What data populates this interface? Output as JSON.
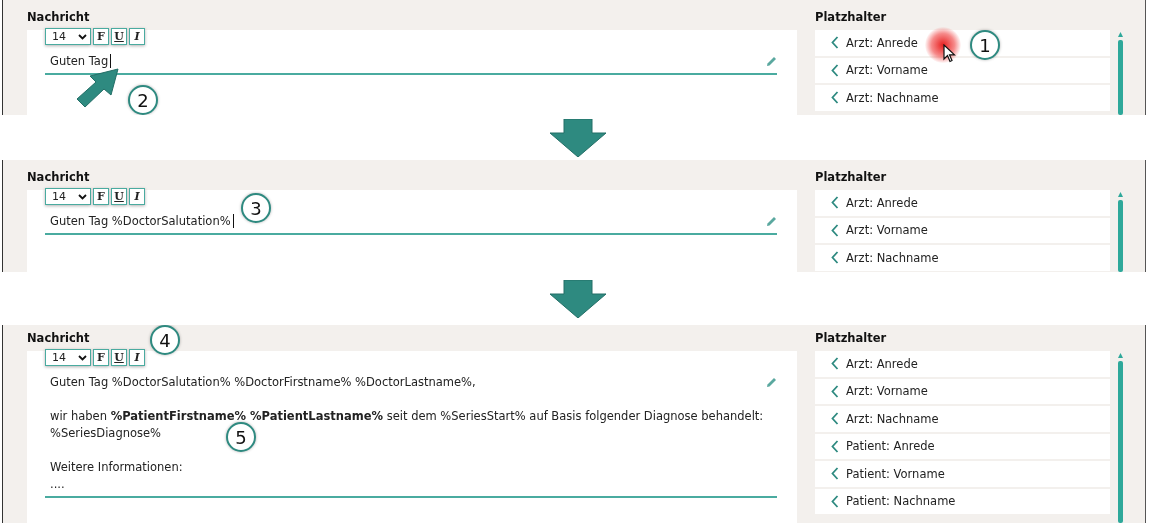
{
  "steps": [
    {
      "editor": {
        "label": "Nachricht",
        "font_size": "14",
        "format_buttons": [
          {
            "kind": "bold",
            "label": "F"
          },
          {
            "kind": "underline",
            "label": "U"
          },
          {
            "kind": "italic",
            "label": "I"
          }
        ],
        "paragraphs": [
          [
            "Guten Tag"
          ]
        ],
        "caret": true
      },
      "placeholders": {
        "label": "Platzhalter",
        "items": [
          "Arzt: Anrede",
          "Arzt: Vorname",
          "Arzt: Nachname"
        ]
      },
      "callouts": [
        {
          "number": "1",
          "kind": "click"
        },
        {
          "number": "2",
          "kind": "pointer"
        }
      ]
    },
    {
      "editor": {
        "label": "Nachricht",
        "font_size": "14",
        "format_buttons": [
          {
            "kind": "bold",
            "label": "F"
          },
          {
            "kind": "underline",
            "label": "U"
          },
          {
            "kind": "italic",
            "label": "I"
          }
        ],
        "paragraphs": [
          [
            "Guten Tag %DoctorSalutation%"
          ]
        ],
        "caret": true
      },
      "placeholders": {
        "label": "Platzhalter",
        "items": [
          "Arzt: Anrede",
          "Arzt: Vorname",
          "Arzt: Nachname"
        ]
      },
      "callouts": [
        {
          "number": "3",
          "kind": "after-text"
        }
      ]
    },
    {
      "editor": {
        "label": "Nachricht",
        "font_size": "14",
        "format_buttons": [
          {
            "kind": "bold",
            "label": "F"
          },
          {
            "kind": "underline",
            "label": "U"
          },
          {
            "kind": "italic",
            "label": "I"
          }
        ],
        "paragraphs": [
          [
            "Guten Tag %DoctorSalutation% %DoctorFirstname% %DoctorLastname%,"
          ],
          [
            "wir haben **%PatientFirstname% %PatientLastname%** seit dem %SeriesStart% auf Basis folgender Diagnose behandelt:",
            "%SeriesDiagnose%"
          ],
          [
            "Weitere Informationen:",
            "...."
          ]
        ],
        "caret": false
      },
      "placeholders": {
        "label": "Platzhalter",
        "items": [
          "Arzt: Anrede",
          "Arzt: Vorname",
          "Arzt: Nachname",
          "Patient: Anrede",
          "Patient: Vorname",
          "Patient: Nachname"
        ]
      },
      "callouts": [
        {
          "number": "4",
          "kind": "toolbar"
        },
        {
          "number": "5",
          "kind": "body"
        }
      ]
    }
  ]
}
